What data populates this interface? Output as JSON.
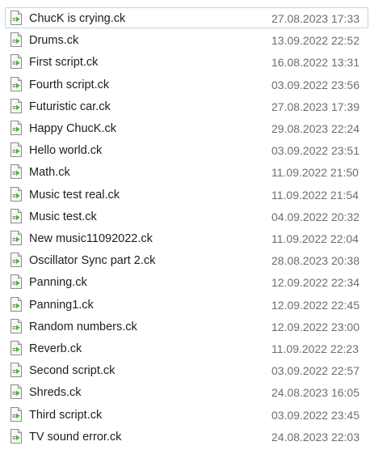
{
  "icon": "chuck-script-file-icon",
  "colors": {
    "icon_arrow": "#4caf3c",
    "icon_lines": "#5f9f4a",
    "focus_border": "#b9d7f2"
  },
  "files": [
    {
      "name": "ChucK is crying.ck",
      "modified": "27.08.2023 17:33"
    },
    {
      "name": "Drums.ck",
      "modified": "13.09.2022 22:52"
    },
    {
      "name": "First script.ck",
      "modified": "16.08.2022 13:31"
    },
    {
      "name": "Fourth script.ck",
      "modified": "03.09.2022 23:56"
    },
    {
      "name": "Futuristic car.ck",
      "modified": "27.08.2023 17:39"
    },
    {
      "name": "Happy ChucK.ck",
      "modified": "29.08.2023 22:24"
    },
    {
      "name": "Hello world.ck",
      "modified": "03.09.2022 23:51"
    },
    {
      "name": "Math.ck",
      "modified": "11.09.2022 21:50"
    },
    {
      "name": "Music test real.ck",
      "modified": "11.09.2022 21:54"
    },
    {
      "name": "Music test.ck",
      "modified": "04.09.2022 20:32"
    },
    {
      "name": "New music11092022.ck",
      "modified": "11.09.2022 22:04"
    },
    {
      "name": "Oscillator Sync part 2.ck",
      "modified": "28.08.2023 20:38"
    },
    {
      "name": "Panning.ck",
      "modified": "12.09.2022 22:34"
    },
    {
      "name": "Panning1.ck",
      "modified": "12.09.2022 22:45"
    },
    {
      "name": "Random numbers.ck",
      "modified": "12.09.2022 23:00"
    },
    {
      "name": "Reverb.ck",
      "modified": "11.09.2022 22:23"
    },
    {
      "name": "Second script.ck",
      "modified": "03.09.2022 22:57"
    },
    {
      "name": "Shreds.ck",
      "modified": "24.08.2023 16:05"
    },
    {
      "name": "Third script.ck",
      "modified": "03.09.2022 23:45"
    },
    {
      "name": "TV sound error.ck",
      "modified": "24.08.2023 22:03"
    }
  ]
}
